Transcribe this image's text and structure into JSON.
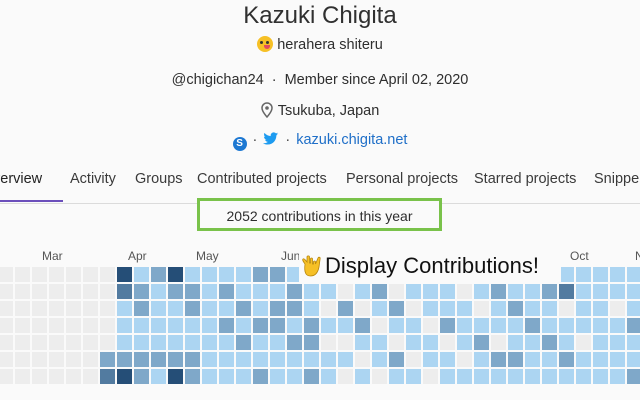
{
  "profile": {
    "name": "Kazuki Chigita",
    "status": "herahera shiteru",
    "status_icon": "zany-face-emoji",
    "username": "@chigichan24",
    "separator": "·",
    "member_since": "Member since April 02, 2020",
    "location": "Tsukuba, Japan",
    "website": "kazuki.chigita.net"
  },
  "tabs": [
    {
      "label": "Overview",
      "shown": "verview",
      "active": true
    },
    {
      "label": "Activity"
    },
    {
      "label": "Groups"
    },
    {
      "label": "Contributed projects"
    },
    {
      "label": "Personal projects"
    },
    {
      "label": "Starred projects"
    },
    {
      "label": "Snippets",
      "shown": "Snippe"
    }
  ],
  "contributions": {
    "summary": "2052 contributions in this year",
    "months": [
      "Mar",
      "Apr",
      "May",
      "Jun",
      "Oct",
      "N"
    ],
    "colors": [
      "#ededed",
      "#acd5f2",
      "#7fa8c9",
      "#527ba0",
      "#254e77"
    ],
    "weeks": [
      [
        0,
        0,
        0,
        0,
        0,
        0,
        0
      ],
      [
        0,
        0,
        0,
        0,
        0,
        0,
        0
      ],
      [
        0,
        0,
        0,
        0,
        0,
        0,
        0
      ],
      [
        0,
        0,
        0,
        0,
        0,
        0,
        0
      ],
      [
        0,
        0,
        0,
        0,
        0,
        0,
        0
      ],
      [
        0,
        0,
        0,
        0,
        0,
        0,
        0
      ],
      [
        0,
        0,
        0,
        0,
        0,
        2,
        3
      ],
      [
        4,
        3,
        1,
        1,
        1,
        2,
        4
      ],
      [
        1,
        2,
        2,
        1,
        1,
        2,
        2
      ],
      [
        2,
        1,
        1,
        1,
        1,
        2,
        1
      ],
      [
        4,
        2,
        1,
        1,
        1,
        2,
        4
      ],
      [
        1,
        2,
        2,
        1,
        1,
        2,
        2
      ],
      [
        1,
        1,
        1,
        1,
        1,
        1,
        1
      ],
      [
        1,
        2,
        1,
        2,
        1,
        1,
        1
      ],
      [
        1,
        1,
        2,
        1,
        2,
        1,
        1
      ],
      [
        2,
        1,
        1,
        2,
        1,
        1,
        2
      ],
      [
        2,
        1,
        2,
        2,
        1,
        1,
        1
      ],
      [
        1,
        2,
        2,
        1,
        2,
        1,
        1
      ],
      [
        1,
        1,
        1,
        2,
        2,
        1,
        2
      ],
      [
        0,
        1,
        0,
        1,
        0,
        1,
        1
      ],
      [
        0,
        0,
        2,
        1,
        0,
        1,
        0
      ],
      [
        1,
        1,
        0,
        2,
        1,
        0,
        1
      ],
      [
        0,
        2,
        1,
        0,
        1,
        1,
        0
      ],
      [
        1,
        0,
        2,
        1,
        0,
        2,
        1
      ],
      [
        0,
        1,
        0,
        1,
        1,
        0,
        1
      ],
      [
        1,
        1,
        1,
        0,
        1,
        1,
        0
      ],
      [
        0,
        1,
        1,
        2,
        0,
        1,
        1
      ],
      [
        1,
        0,
        1,
        1,
        1,
        0,
        1
      ],
      [
        2,
        1,
        0,
        1,
        2,
        1,
        1
      ],
      [
        1,
        2,
        1,
        1,
        0,
        2,
        1
      ],
      [
        1,
        1,
        2,
        1,
        1,
        2,
        1
      ],
      [
        0,
        1,
        1,
        2,
        1,
        1,
        1
      ],
      [
        1,
        2,
        1,
        1,
        2,
        1,
        1
      ],
      [
        1,
        3,
        0,
        1,
        1,
        2,
        1
      ],
      [
        1,
        1,
        1,
        1,
        0,
        1,
        1
      ],
      [
        1,
        1,
        1,
        1,
        1,
        1,
        1
      ],
      [
        1,
        1,
        0,
        1,
        1,
        1,
        1
      ],
      [
        1,
        1,
        1,
        2,
        1,
        1,
        2
      ]
    ]
  },
  "callout": {
    "text": "Display Contributions!",
    "icon": "love-you-gesture-emoji"
  }
}
